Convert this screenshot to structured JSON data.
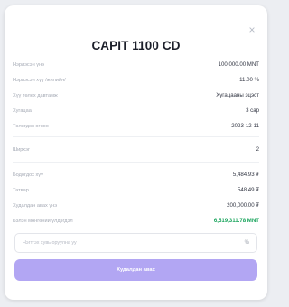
{
  "modal": {
    "title": "CAPIT 1100 CD",
    "close_label": "×",
    "rows_top": [
      {
        "label": "Нэрлэсэн үнэ",
        "value": "100,000.00 MNT"
      },
      {
        "label": "Нэрлэсэн хүү /жилийн/",
        "value": "11.00 %"
      },
      {
        "label": "Хүү төлөх давтамж",
        "value": "Хугацааны эцэст"
      },
      {
        "label": "Хугацаа",
        "value": "3 сар"
      },
      {
        "label": "Төлөгдөх огноо",
        "value": "2023-12-11"
      }
    ],
    "rows_mid": [
      {
        "label": "Ширхэг",
        "value": "2"
      }
    ],
    "rows_bottom": [
      {
        "label": "Бодогдох хүү",
        "value": "5,484.93 ₮"
      },
      {
        "label": "Татвар",
        "value": "548.49 ₮"
      },
      {
        "label": "Худалдан авах үнэ",
        "value": "200,000.00 ₮"
      },
      {
        "label": "Бэлэн мөнгөний үлдэгдэл",
        "value": "6,519,311.78 MNT"
      }
    ],
    "input": {
      "placeholder": "Нэгтгэх хувь оруулна уу",
      "suffix": "%"
    },
    "submit_label": "Худалдан авах",
    "accent": "#b2a6f3",
    "green": "#16a35a"
  }
}
